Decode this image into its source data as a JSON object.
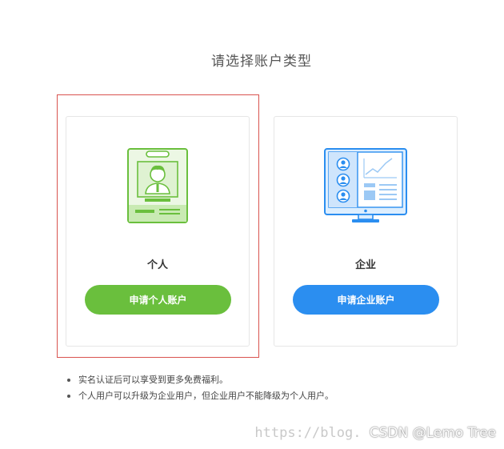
{
  "page": {
    "title": "请选择账户类型"
  },
  "cards": {
    "personal": {
      "label": "个人",
      "button_label": "申请个人账户",
      "icon": "personal-id-card-icon",
      "accent_color": "#6abf3d"
    },
    "enterprise": {
      "label": "企业",
      "button_label": "申请企业账户",
      "icon": "enterprise-monitor-icon",
      "accent_color": "#2b8ef0"
    }
  },
  "notes": [
    "实名认证后可以享受到更多免费福利。",
    "个人用户可以升级为企业用户，但企业用户不能降级为个人用户。"
  ],
  "watermark": {
    "url": "https://blog.",
    "brand": "CSDN @Lemo Tree"
  },
  "colors": {
    "selection_border": "#d9534f",
    "card_border": "#e6e6e6"
  }
}
